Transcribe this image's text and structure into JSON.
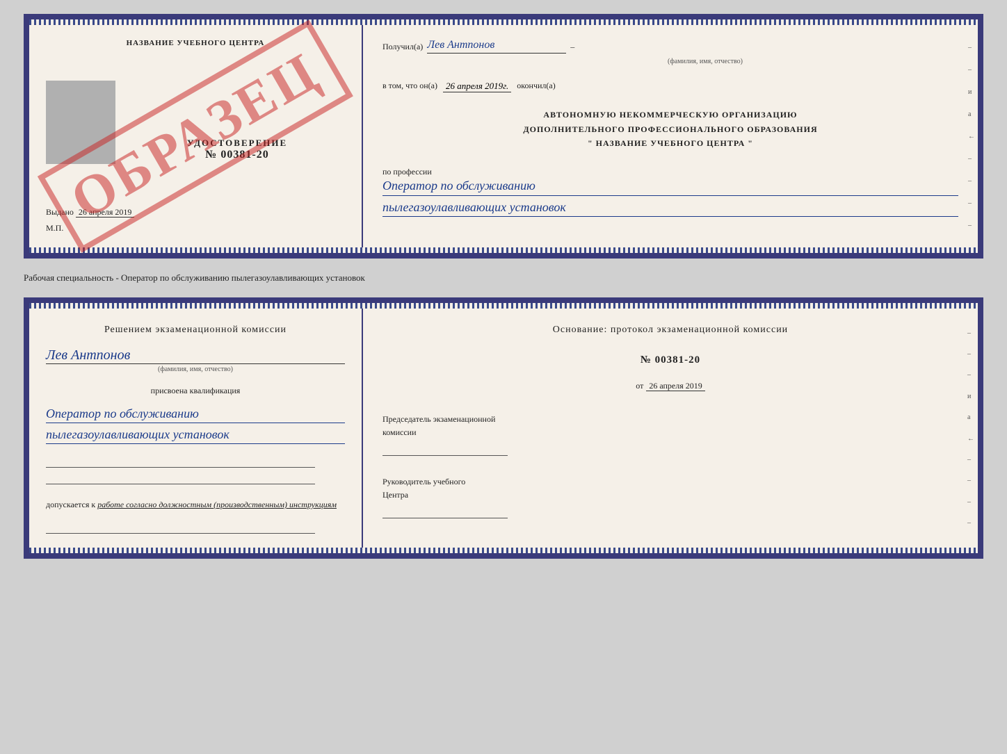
{
  "doc1": {
    "left": {
      "title": "НАЗВАНИЕ УЧЕБНОГО ЦЕНТРА",
      "cert_label": "УДОСТОВЕРЕНИЕ",
      "cert_number": "№ 00381-20",
      "issued_label": "Выдано",
      "issued_date": "26 апреля 2019",
      "mp_label": "М.П.",
      "watermark": "ОБРАЗЕЦ"
    },
    "right": {
      "received_label": "Получил(а)",
      "recipient_name": "Лев Антпонов",
      "fio_label": "(фамилия, имя, отчество)",
      "that_label": "в том, что он(а)",
      "date_value": "26 апреля 2019г.",
      "finished_label": "окончил(а)",
      "org_line1": "АВТОНОМНУЮ НЕКОММЕРЧЕСКУЮ ОРГАНИЗАЦИЮ",
      "org_line2": "ДОПОЛНИТЕЛЬНОГО ПРОФЕССИОНАЛЬНОГО ОБРАЗОВАНИЯ",
      "org_line3": "\"   НАЗВАНИЕ УЧЕБНОГО ЦЕНТРА   \"",
      "profession_label": "по профессии",
      "profession_line1": "Оператор по обслуживанию",
      "profession_line2": "пылегазоулавливающих установок"
    }
  },
  "separator": {
    "text": "Рабочая специальность - Оператор по обслуживанию пылегазоулавливающих установок"
  },
  "doc2": {
    "left": {
      "decision_label": "Решением экзаменационной комиссии",
      "person_name": "Лев Антпонов",
      "fio_label": "(фамилия, имя, отчество)",
      "qualification_label": "присвоена квалификация",
      "qualification_line1": "Оператор по обслуживанию",
      "qualification_line2": "пылегазоулавливающих установок",
      "allowed_label": "допускается к",
      "allowed_text": "работе согласно должностным (производственным) инструкциям"
    },
    "right": {
      "basis_label": "Основание: протокол экзаменационной комиссии",
      "number_label": "№ 00381-20",
      "date_prefix": "от",
      "date_value": "26 апреля 2019",
      "chairman_line1": "Председатель экзаменационной",
      "chairman_line2": "комиссии",
      "head_line1": "Руководитель учебного",
      "head_line2": "Центра"
    }
  }
}
